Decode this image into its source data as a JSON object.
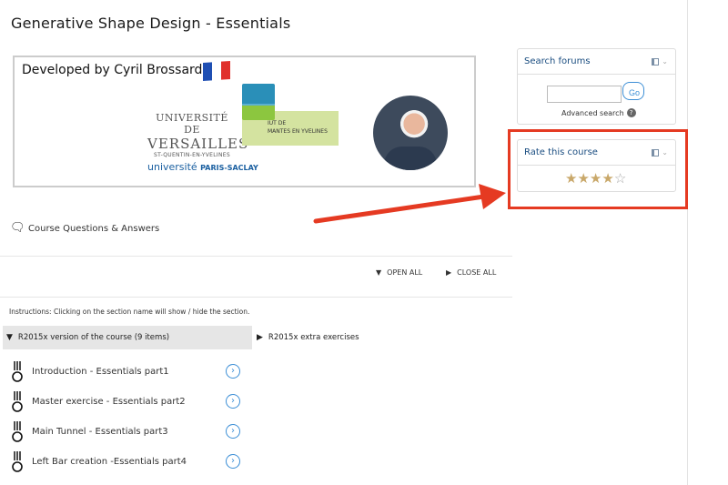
{
  "page": {
    "title": "Generative Shape Design - Essentials"
  },
  "banner": {
    "title": "Developed by Cyril Brossard",
    "flag_colors": [
      "#1f4fb3",
      "#ffffff",
      "#e0312c"
    ],
    "uvsq_line1": "UNIVERSITÉ DE",
    "uvsq_line2": "VERSAILLES",
    "uvsq_line3": "ST-QUENTIN-EN-YVELINES",
    "iut_line1": "IUT DE",
    "iut_line2": "MANTES EN YVELINES",
    "paris_saclay_1": "université",
    "paris_saclay_2": "PARIS-SACLAY"
  },
  "qa": {
    "icon": "chat-bubbles-icon",
    "label": "Course Questions & Answers"
  },
  "toggles": {
    "open_all": "OPEN ALL",
    "close_all": "CLOSE ALL"
  },
  "instructions": "Instructions: Clicking on the section name will show / hide the section.",
  "tabs": [
    {
      "label": "R2015x version of the course (9 items)",
      "expanded": true
    },
    {
      "label": "R2015x extra exercises",
      "expanded": false
    }
  ],
  "lessons": [
    {
      "label": "Introduction - Essentials part1"
    },
    {
      "label": "Master exercise - Essentials part2"
    },
    {
      "label": "Main Tunnel - Essentials part3"
    },
    {
      "label": "Left Bar creation -Essentials part4"
    }
  ],
  "search_forums": {
    "title": "Search forums",
    "go_label": "Go",
    "advanced": "Advanced search",
    "help": "?"
  },
  "rate": {
    "title": "Rate this course",
    "rating": 4,
    "max": 5,
    "star_color": "#c9a86a"
  },
  "colors": {
    "accent_blue": "#3d8fd6",
    "highlight_red": "#e53a22",
    "header_blue": "#1a4d80"
  }
}
